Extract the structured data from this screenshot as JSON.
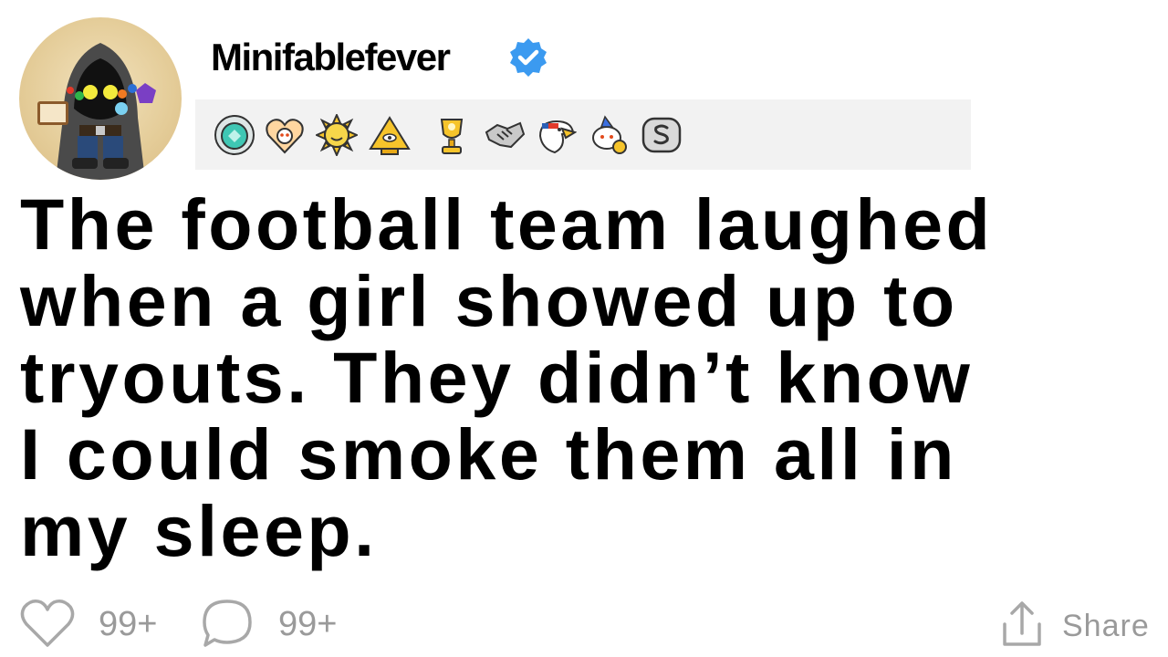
{
  "post": {
    "username": "Minifablefever",
    "verified_icon": "verified-badge-icon",
    "awards": [
      "diamond-award-icon",
      "heart-snoo-award-icon",
      "sun-award-icon",
      "pyramid-eye-award-icon",
      "gold-trophy-award-icon",
      "handshake-award-icon",
      "eagle-award-icon",
      "snoo-party-award-icon",
      "silver-s-award-icon"
    ],
    "text": "The football team laughed\nwhen a girl showed up to\ntryouts. They didn’t know\nI could smoke them all in\nmy sleep."
  },
  "footer": {
    "likes": "99+",
    "comments": "99+",
    "share_label": "Share"
  },
  "colors": {
    "verified_blue": "#3b9af0",
    "meta_gray": "#9a9a9a",
    "awards_bg": "#f2f2f2"
  }
}
